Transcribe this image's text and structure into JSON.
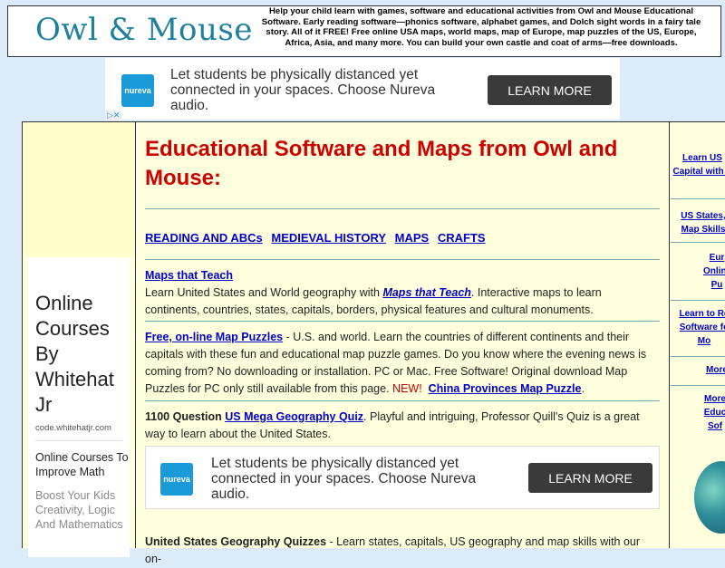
{
  "header": {
    "logo": "Owl & Mouse",
    "intro": "Help your child learn with games, software and educational activities from Owl and Mouse Educational Software.   Early reading software—phonics software, alphabet games, and Dolch sight words in a fairy tale story.  All of it FREE!  Free online USA maps, world maps, map of Europe, map puzzles of the US, Europe, Africa, Asia, and many more.  You can build your own castle and coat of arms—free downloads."
  },
  "ads": {
    "logo_text": "nureva",
    "text": "Let students be physically distanced yet connected in your spaces. Choose Nureva audio.",
    "button": "LEARN MORE",
    "adchoices": "▷✕"
  },
  "left_ad": {
    "headline": "Online Courses By Whitehat Jr",
    "domain": "code.whitehatjr.com",
    "subhead": "Online Courses To Improve Math",
    "body": "Boost Your Kids Creativity, Logic And Mathematics"
  },
  "main": {
    "title": "Educational Software and Maps from Owl and Mouse:",
    "nav": [
      "READING AND ABCs",
      "MEDIEVAL HISTORY",
      "MAPS",
      "CRAFTS"
    ],
    "maps_teach": {
      "heading": "Maps that Teach",
      "text1": "Learn United States and World geography with ",
      "link": "Maps that Teach",
      "text2": ".  Interactive maps to learn continents, countries, states, capitals, borders, physical features and cultural monuments."
    },
    "puzzles": {
      "link": "Free, on-line Map Puzzles",
      "text": " - U.S. and world. Learn the countries of different continents and their capitals with these fun and educational map puzzle games. Do you know where the evening news is coming from?  No downloading or installation.  PC or Mac.  Free Software!  Original download Map Puzzles for PC only still available from this page.  ",
      "new": "NEW!",
      "link2": "China Provinces Map Puzzle",
      "end": "."
    },
    "quiz": {
      "prefix": "1100 Question ",
      "link": "US Mega Geography Quiz",
      "text": ". Playful and intriguing, Professor Quill's Quiz is a great way to learn about the United States."
    },
    "quizzes": {
      "heading": "United States Geography Quizzes",
      "text": " - Learn states, capitals, US geography and map skills with our on-"
    }
  },
  "right_col": {
    "links": [
      "Learn US Capital with q",
      "US States, Map Skills",
      "Eur Online Pu",
      "Learn to Re Software fo Mo",
      "More",
      "More Educ Sof"
    ]
  }
}
